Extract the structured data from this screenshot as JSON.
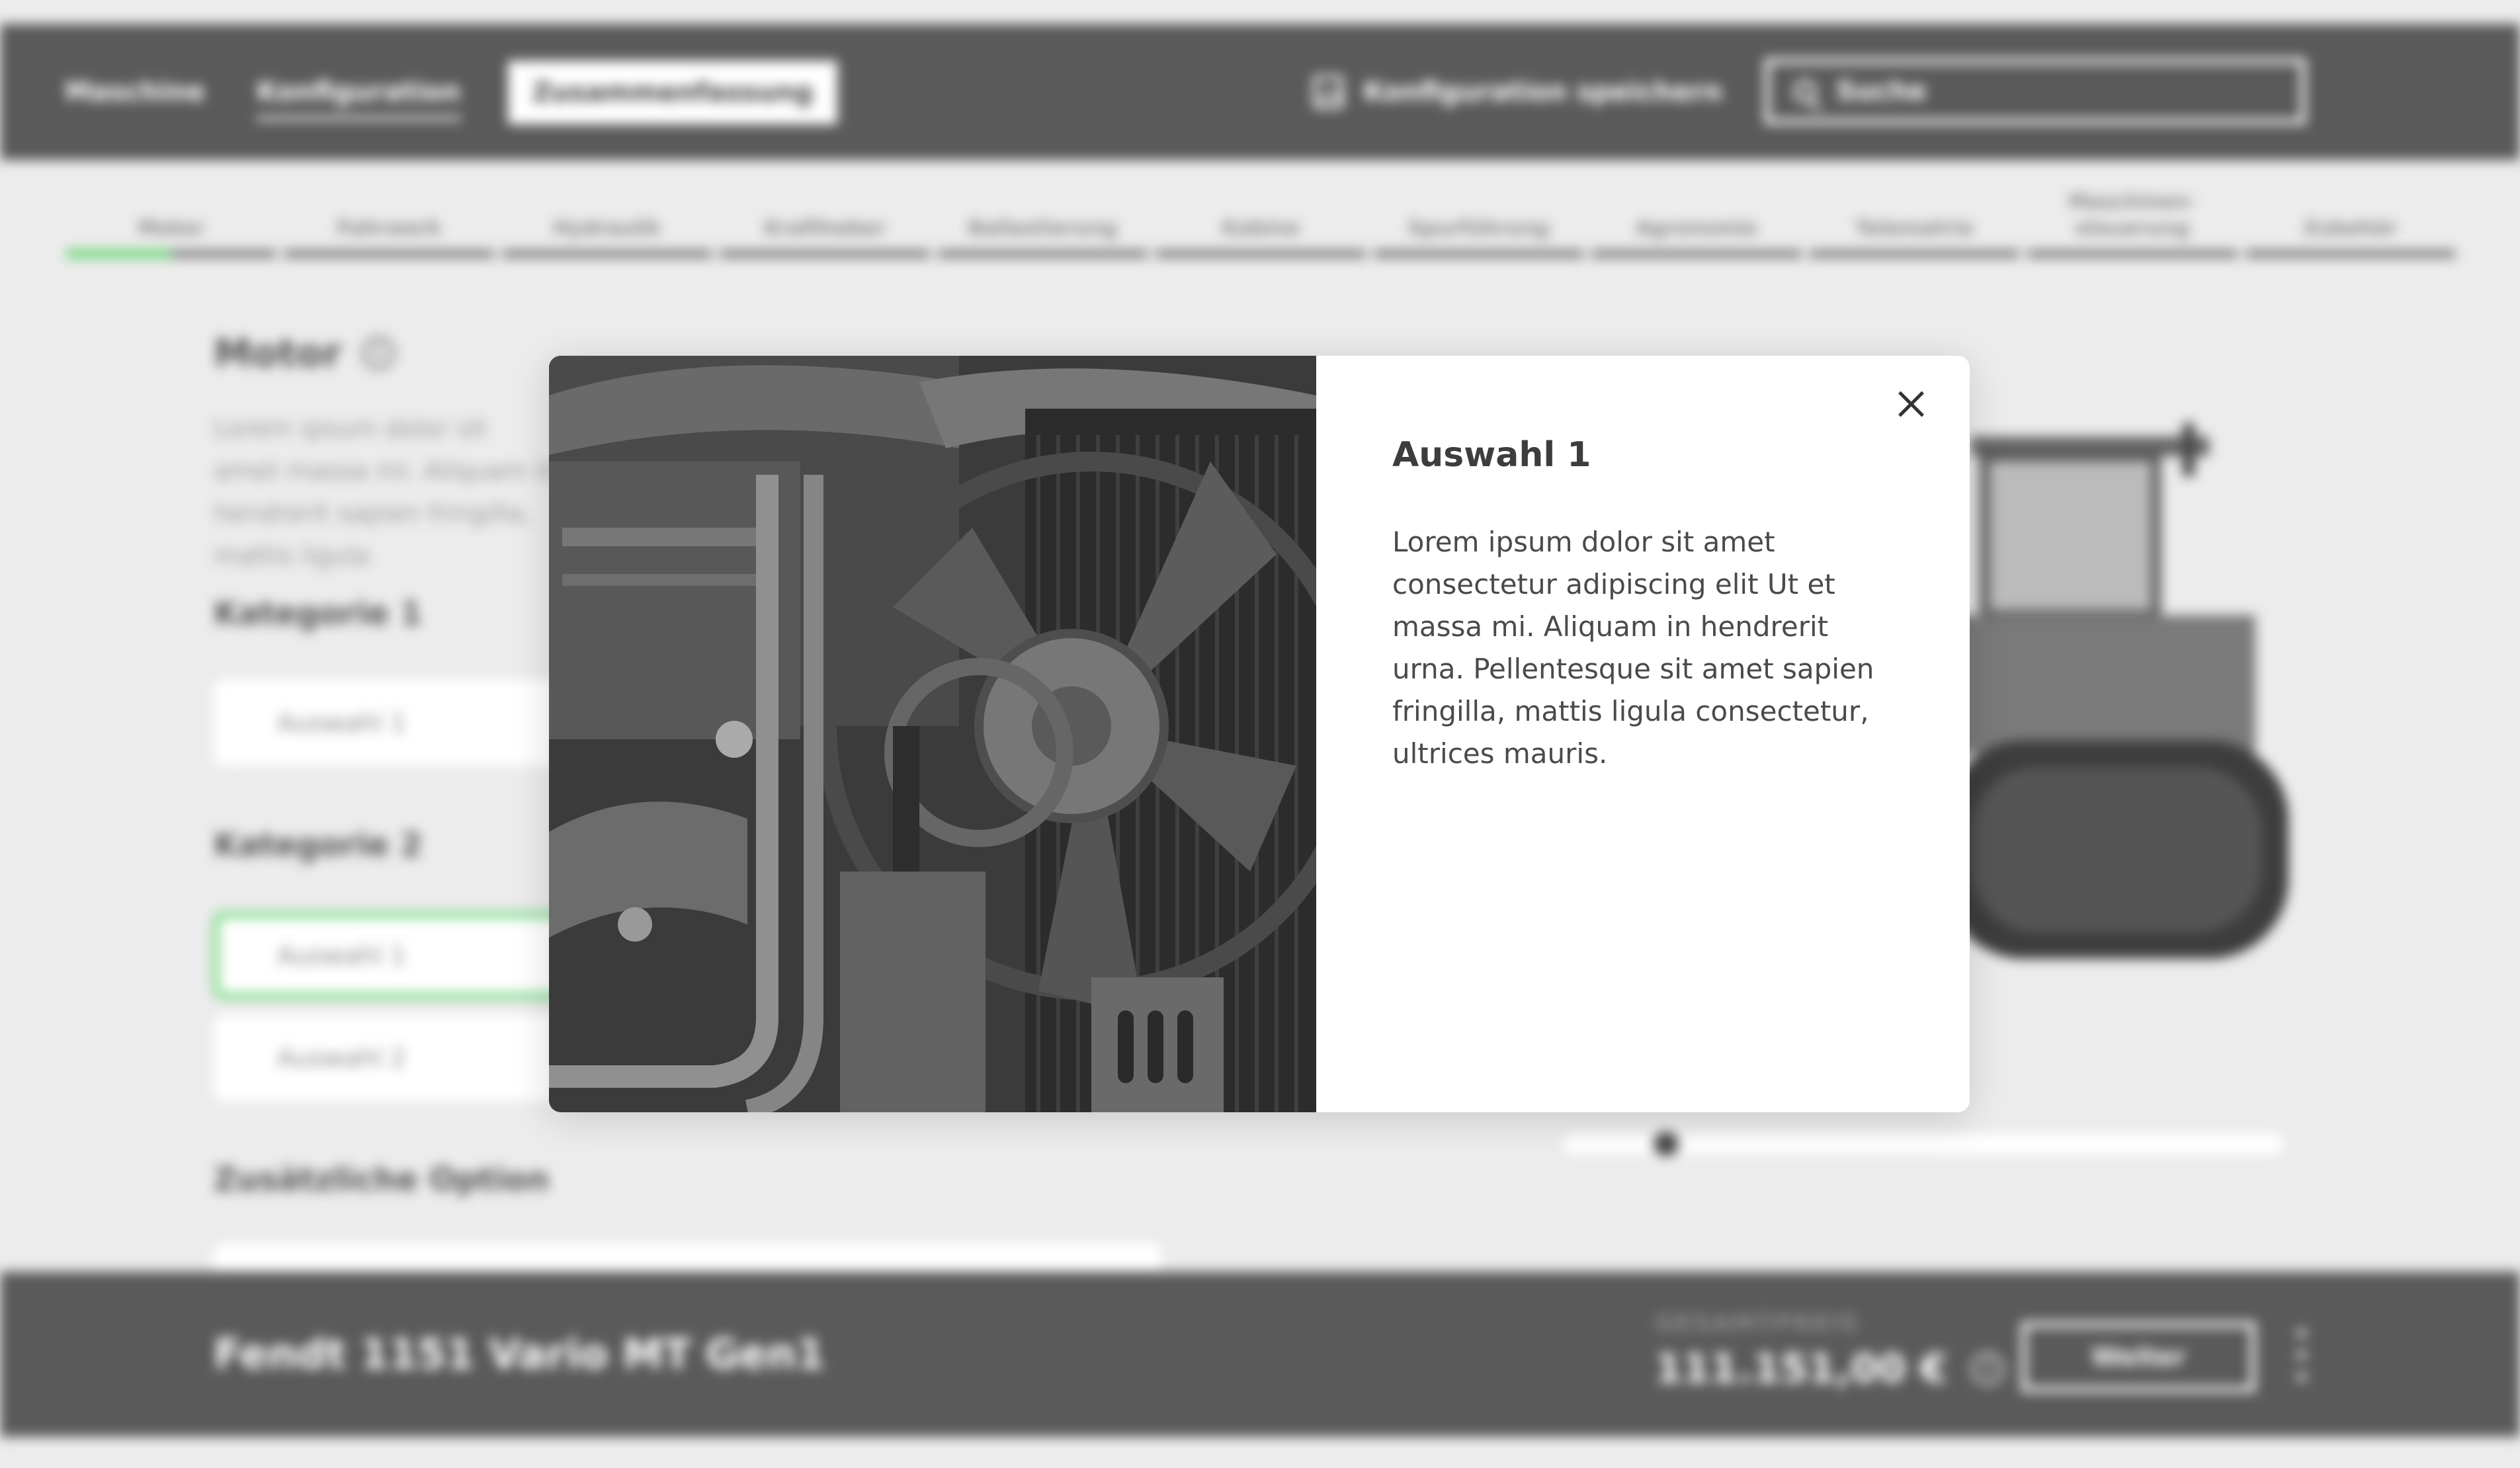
{
  "topnav": {
    "items": [
      {
        "label": "Maschine"
      },
      {
        "label": "Konfiguration"
      },
      {
        "label": "Zusammenfassung"
      }
    ],
    "save_label": "Konfiguration speichern",
    "search_placeholder": "Suche"
  },
  "steps": [
    {
      "label": "Motor"
    },
    {
      "label": "Fahrwerk"
    },
    {
      "label": "Hydraulik"
    },
    {
      "label": "Kraftheber"
    },
    {
      "label": "Ballastierung"
    },
    {
      "label": "Kabine"
    },
    {
      "label": "Spurführung"
    },
    {
      "label": "Agronomie"
    },
    {
      "label": "Telematrie"
    },
    {
      "label": "Maschinen-\nsteuerung"
    },
    {
      "label": "Zubehör"
    }
  ],
  "progress": {
    "active_step": 0,
    "active_step_fill": 0.5
  },
  "content": {
    "title": "Motor",
    "description": "Lorem ipsum dolor sit amet massa mi. Aliquam in hendrerit sapien fringilla, mattis ligula",
    "category1": {
      "title": "Kategorie 1",
      "options": [
        "Auswahl 1"
      ]
    },
    "category2": {
      "title": "Kategorie 2",
      "options": [
        "Auswahl 1",
        "Auswahl 2"
      ]
    },
    "extra_title": "Zusätzliche Option"
  },
  "bottombar": {
    "machine_name": "Fendt 1151 Vario MT Gen1",
    "price_label": "GESAMTPREIS",
    "price_value": "111.151,00 €",
    "next_label": "Weiter"
  },
  "modal": {
    "title": "Auswahl 1",
    "text": "Lorem ipsum dolor sit amet consectetur adipiscing elit Ut et massa mi. Aliquam in hendrerit urna. Pellentesque sit amet sapien fringilla, mattis ligula consectetur, ultrices mauris."
  },
  "colors": {
    "accent": "#5dd46c",
    "bar": "#5a5a5a",
    "background": "#ececec"
  },
  "icons": [
    "save-icon",
    "search-icon",
    "info-icon",
    "close-icon",
    "more-vertical-icon"
  ]
}
